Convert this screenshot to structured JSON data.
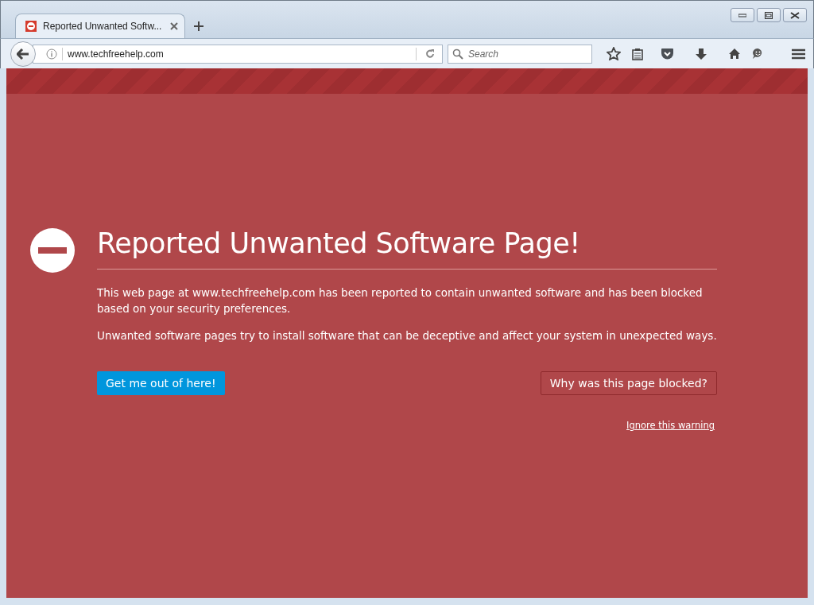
{
  "tab": {
    "title": "Reported Unwanted Softw...",
    "selected": true
  },
  "address_bar": {
    "url": "www.techfreehelp.com"
  },
  "search": {
    "placeholder": "Search"
  },
  "page": {
    "heading": "Reported Unwanted Software Page!",
    "paragraphs": [
      "This web page at www.techfreehelp.com has been reported to contain unwanted software and has been blocked based on your security preferences.",
      "Unwanted software pages try to install software that can be deceptive and affect your system in unexpected ways."
    ],
    "primary_button": "Get me out of here!",
    "secondary_button": "Why was this page blocked?",
    "ignore_link": "Ignore this warning"
  }
}
